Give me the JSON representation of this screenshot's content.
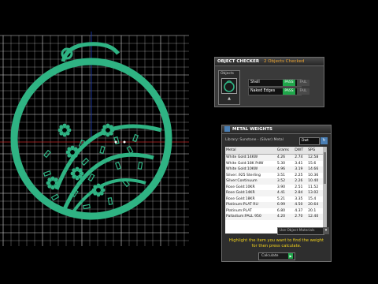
{
  "colors": {
    "jewel": "#2fb383",
    "grid": "#d8d8d8",
    "pass": "#1fa64a",
    "hint": "#f2d21b"
  },
  "object_checker": {
    "title": "OBJECT CHECKER",
    "status": "2 Objects Checked",
    "objects_label": "Objects",
    "rows": [
      {
        "label": "Shell",
        "pass": "PASS",
        "fail": "FAIL"
      },
      {
        "label": "Naked Edges",
        "pass": "PASS",
        "fail": "FAIL"
      }
    ]
  },
  "metal_weights": {
    "title": "METAL WEIGHTS",
    "library": "Library: Sunstone - (Silver) Metal",
    "unit": "Dwt",
    "columns": [
      "Metal",
      "Grams",
      "DWT",
      "SPG"
    ],
    "rows": [
      [
        "White Gold:14KW",
        "4.26",
        "2.74",
        "12.58"
      ],
      [
        "White Gold:18K PdW",
        "5.30",
        "3.41",
        "15.6"
      ],
      [
        "White Gold:10KW",
        "4.96",
        "3.19",
        "14.66"
      ],
      [
        "Silver:.925 Sterling",
        "3.51",
        "2.25",
        "10.36"
      ],
      [
        "Silver:Continuum",
        "3.52",
        "2.26",
        "10.40"
      ],
      [
        "Rose Gold:10KR",
        "3.90",
        "2.51",
        "11.52"
      ],
      [
        "Rose Gold:14KR",
        "4.41",
        "2.84",
        "13.02"
      ],
      [
        "Rose Gold:18KR",
        "5.21",
        "3.35",
        "15.4"
      ],
      [
        "Platinum:PLAT RU",
        "6.99",
        "4.50",
        "20.64"
      ],
      [
        "Platinum:PLAT",
        "6.80",
        "4.37",
        "20.1"
      ],
      [
        "Palladium:PALL 950",
        "4.20",
        "2.70",
        "12.40"
      ]
    ],
    "select_value": "Use Object Materials",
    "hint": "Highlight the item you want to find the weight for then press calculate.",
    "calculate": "Calculate"
  }
}
